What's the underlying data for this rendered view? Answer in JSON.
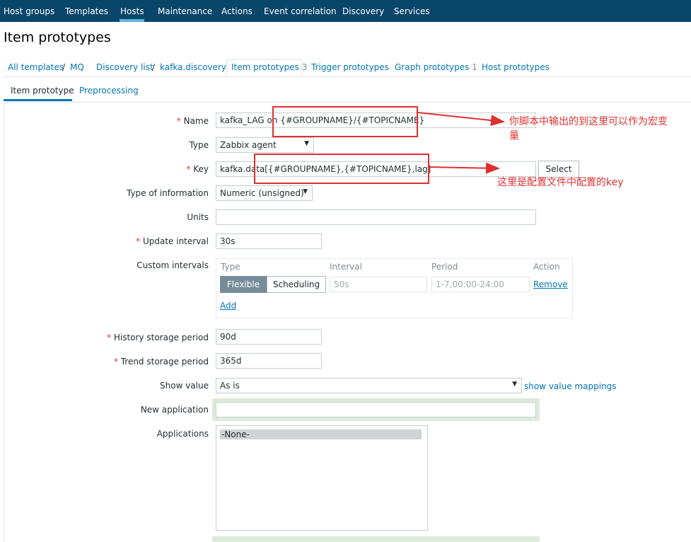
{
  "topnav": {
    "items": [
      "Host groups",
      "Templates",
      "Hosts",
      "Maintenance",
      "Actions",
      "Event correlation",
      "Discovery",
      "Services"
    ],
    "active": "Hosts"
  },
  "page_title": "Item prototypes",
  "breadcrumbs": {
    "all_templates": "All templates",
    "sep": "/",
    "template": "MQ",
    "discovery_list": "Discovery list",
    "discovery_rule": "kafka.discovery",
    "item_prototypes": "Item prototypes",
    "item_prototypes_count": "3",
    "trigger_prototypes": "Trigger prototypes",
    "graph_prototypes": "Graph prototypes",
    "graph_prototypes_count": "1",
    "host_prototypes": "Host prototypes"
  },
  "tabs": [
    "Item prototype",
    "Preprocessing"
  ],
  "form": {
    "name_label": "Name",
    "name_value": "kafka_LAG on {#GROUPNAME}/{#TOPICNAME}",
    "type_label": "Type",
    "type_value": "Zabbix agent",
    "key_label": "Key",
    "key_value": "kafka.data[{#GROUPNAME},{#TOPICNAME},lag]",
    "key_select": "Select",
    "info_label": "Type of information",
    "info_value": "Numeric (unsigned)",
    "units_label": "Units",
    "units_value": "",
    "update_label": "Update interval",
    "update_value": "30s",
    "custom_label": "Custom intervals",
    "custom": {
      "col_type": "Type",
      "col_interval": "Interval",
      "col_period": "Period",
      "col_action": "Action",
      "flexible": "Flexible",
      "scheduling": "Scheduling",
      "interval_ph": "50s",
      "period_ph": "1-7,00:00-24:00",
      "remove": "Remove",
      "add": "Add"
    },
    "history_label": "History storage period",
    "history_value": "90d",
    "trend_label": "Trend storage period",
    "trend_value": "365d",
    "show_label": "Show value",
    "show_value": "As is",
    "show_mappings": "show value mappings",
    "newapp_label": "New application",
    "apps_label": "Applications",
    "apps_option": "-None-"
  },
  "annotations": {
    "note1_line1": "你脚本中输出的到这里可以作为宏变",
    "note1_line2": "量",
    "note2": "这里是配置文件中配置的key"
  },
  "colors": {
    "nav_bg": "#0a466a",
    "link": "#0275b8",
    "required": "#e33734",
    "annotation": "#e03030"
  }
}
